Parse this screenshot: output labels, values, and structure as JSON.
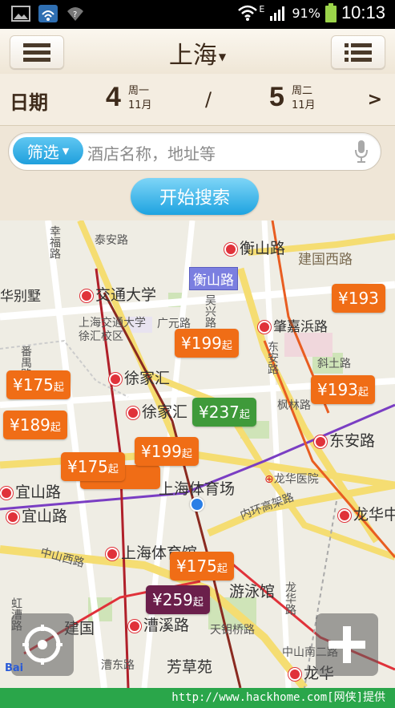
{
  "status_bar": {
    "network": "E",
    "battery": "91%",
    "time": "10:13"
  },
  "header": {
    "city": "上海",
    "menu_icon": "hamburger-icon",
    "list_icon": "list-icon"
  },
  "date_row": {
    "label": "日期",
    "checkin": {
      "day": "4",
      "weekday": "周一",
      "month": "11月"
    },
    "separator": "/",
    "checkout": {
      "day": "5",
      "weekday": "周二",
      "month": "11月"
    },
    "next": ">"
  },
  "search": {
    "filter_label": "筛选",
    "placeholder": "酒店名称，地址等",
    "mic_icon": "microphone-icon",
    "start_button": "开始搜索"
  },
  "map": {
    "labels": [
      "幸福路",
      "泰安路",
      "衡山路",
      "建国西路",
      "华别墅",
      "交通大学",
      "衡山路",
      "上海交通大学徐汇校区",
      "广元路",
      "吴兴路",
      "肇嘉浜路",
      "东安路",
      "徐家汇",
      "斜土路",
      "番禺路",
      "徐家汇",
      "枫林路",
      "东安路",
      "宜山路",
      "宜山路",
      "上海体育场",
      "龙华医院",
      "内环高架路",
      "龙华中",
      "中山西路",
      "上海体育馆",
      "游泳馆",
      "龙华路",
      "漕溪路",
      "虹漕路",
      "建国",
      "漕东路",
      "芳草苑",
      "龙华",
      "天钥桥路",
      "中山南二路"
    ],
    "price_pins": [
      {
        "price": "¥193",
        "suffix": "",
        "color": "orange"
      },
      {
        "price": "¥199",
        "suffix": "起",
        "color": "orange"
      },
      {
        "price": "¥175",
        "suffix": "起",
        "color": "orange"
      },
      {
        "price": "¥193",
        "suffix": "起",
        "color": "orange"
      },
      {
        "price": "¥237",
        "suffix": "起",
        "color": "green"
      },
      {
        "price": "¥189",
        "suffix": "起",
        "color": "orange"
      },
      {
        "price": "¥199",
        "suffix": "起",
        "color": "orange"
      },
      {
        "price": "¥175",
        "suffix": "起",
        "color": "orange"
      },
      {
        "price": "¥175",
        "suffix": "起",
        "color": "orange"
      },
      {
        "price": "¥259",
        "suffix": "起",
        "color": "purple"
      }
    ],
    "locate_icon": "locate-icon",
    "zoom_icon": "plus-icon",
    "logo": "Bai"
  },
  "footer": {
    "text": "http://www.hackhome.com[网侠]提供"
  },
  "colors": {
    "accent_blue": "#1ea3e0",
    "pin_orange": "#f06d16",
    "pin_green": "#3f9a3a",
    "pin_purple": "#6b1f4b",
    "footer_green": "#2aa64a"
  }
}
